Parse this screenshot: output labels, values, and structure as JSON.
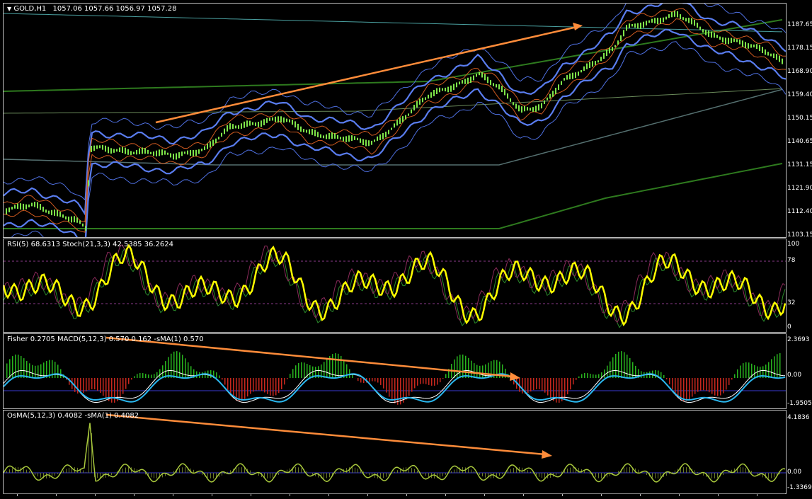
{
  "main": {
    "symbol": "GOLD,H1",
    "ohlc": "1057.06 1057.66 1056.97 1057.28",
    "menu_icon": "triangle-down-icon",
    "price_ticks": [
      "1187.65",
      "1178.15",
      "1168.90",
      "1159.40",
      "1150.15",
      "1140.65",
      "1131.15",
      "1121.90",
      "1112.40",
      "1103.15"
    ]
  },
  "rsi_pane": {
    "label": "RSI(5) 68.6313  Stoch(21,3,3) 42.5385 36.2624",
    "ticks": [
      "100",
      "78",
      "32",
      "0"
    ]
  },
  "macd_pane": {
    "label": "Fisher 0.2705  MACD(5,12,3) 0.570 0.162  -sMA(1) 0.570",
    "ticks": [
      "2.3693",
      "0.00",
      "-1.9505"
    ]
  },
  "osma_pane": {
    "label": "OsMA(5,12,3) 0.4082  -sMA(1) 0.4082",
    "ticks": [
      "4.1836",
      "0.00",
      "-1.3369"
    ]
  },
  "colors": {
    "candle": "#7fe64a",
    "band_blue": "#5a7df0",
    "band_green": "#2e7a1e",
    "trend_arrow": "#ff8c3a",
    "rsi_line": "#ffff00",
    "hist_up": "#28b41e",
    "hist_down": "#c8281e",
    "macd_line": "#2ab8f0",
    "osma_line": "#a8c83c"
  }
}
